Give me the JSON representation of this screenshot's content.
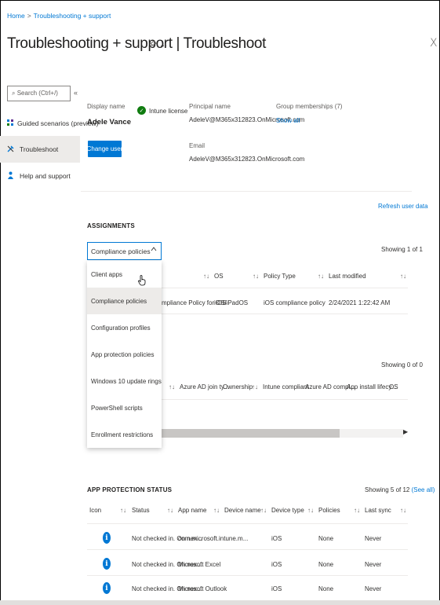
{
  "breadcrumb": {
    "home": "Home",
    "sep": ">",
    "current": "Troubleshooting + support"
  },
  "header": {
    "title": "Troubleshooting + support",
    "divider": "|",
    "subtitle": "Troubleshoot",
    "pin_icon": "pin-icon",
    "more": "...",
    "close": "X"
  },
  "sidebar": {
    "search_placeholder": "Search (Ctrl+/)",
    "collapse": "«",
    "items": [
      {
        "label": "Guided scenarios (preview)",
        "icon": "scenarios-icon"
      },
      {
        "label": "Troubleshoot",
        "icon": "wrench-icon"
      },
      {
        "label": "Help and support",
        "icon": "person-help-icon"
      }
    ]
  },
  "user": {
    "display_name_label": "Display name",
    "display_name": "Adele Vance",
    "license": "Intune license",
    "principal_label": "Principal name",
    "principal": "AdeleV@M365x312823.OnMicrosoft.com",
    "groups_label": "Group memberships (7)",
    "groups_link": "Show all",
    "email_label": "Email",
    "email": "AdeleV@M365x312823.OnMicrosoft.com",
    "change_user": "Change user",
    "refresh": "Refresh user data"
  },
  "assignments": {
    "title": "ASSIGNMENTS",
    "selected": "Compliance policies",
    "showing": "Showing 1 of 1",
    "options": [
      "Client apps",
      "Compliance policies",
      "Configuration profiles",
      "App protection policies",
      "Windows 10 update rings",
      "PowerShell scripts",
      "Enrollment restrictions"
    ],
    "columns": {
      "sort": "↑↓",
      "os": "OS",
      "policy_type": "Policy Type",
      "last_modified": "Last modified"
    },
    "row": {
      "name_fragment": "mpliance Policy for iOS",
      "os": "iOS/iPadOS",
      "policy_type": "iOS compliance policy",
      "last_modified": "2/24/2021 1:22:42 AM"
    }
  },
  "devices": {
    "showing": "Showing 0 of 0",
    "columns": [
      "Azure AD join ty...",
      "Ownership",
      "Intune compliant",
      "Azure AD compl...",
      "App install lifecy...",
      "OS"
    ],
    "sort": "↑↓",
    "scroll_right": "▶"
  },
  "app_protection": {
    "title": "APP PROTECTION STATUS",
    "showing": "Showing 5 of 12",
    "see_all": "(See all)",
    "columns": [
      "Icon",
      "Status",
      "App name",
      "Device name",
      "Device type",
      "Policies",
      "Last sync"
    ],
    "sort": "↑↓",
    "rows": [
      {
        "status": "Not checked in. On nex...",
        "app": "com.microsoft.intune.m...",
        "device": "",
        "type": "iOS",
        "policies": "None",
        "sync": "Never"
      },
      {
        "status": "Not checked in. On nex...",
        "app": "Microsoft Excel",
        "device": "",
        "type": "iOS",
        "policies": "None",
        "sync": "Never"
      },
      {
        "status": "Not checked in. On nex...",
        "app": "Microsoft Outlook",
        "device": "",
        "type": "iOS",
        "policies": "None",
        "sync": "Never"
      }
    ]
  },
  "colors": {
    "accent": "#0078d4",
    "success": "#107c10",
    "selected_bg": "#edebe9"
  }
}
